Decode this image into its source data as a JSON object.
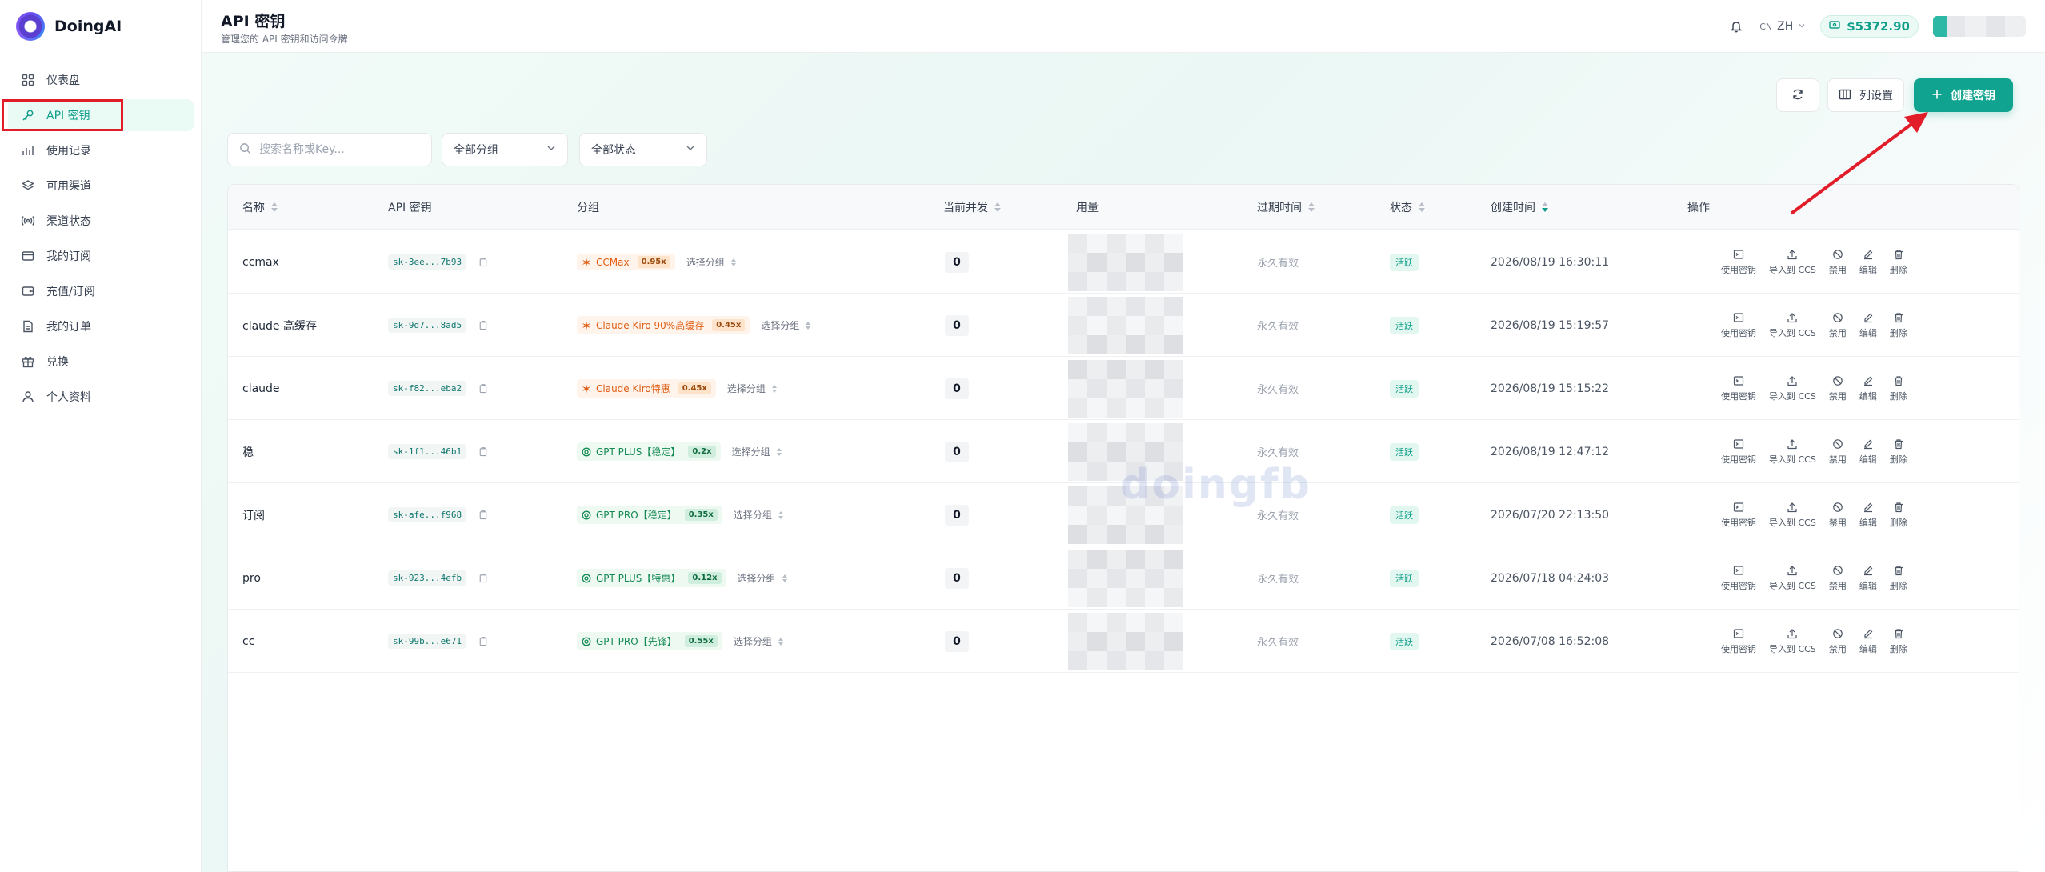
{
  "brand": {
    "name": "DoingAI"
  },
  "sidebar": {
    "items": [
      {
        "label": "仪表盘",
        "icon": "grid-icon"
      },
      {
        "label": "API 密钥",
        "icon": "key-icon",
        "active": true
      },
      {
        "label": "使用记录",
        "icon": "bar-chart-icon"
      },
      {
        "label": "可用渠道",
        "icon": "layers-icon"
      },
      {
        "label": "渠道状态",
        "icon": "signal-icon"
      },
      {
        "label": "我的订阅",
        "icon": "card-icon"
      },
      {
        "label": "充值/订阅",
        "icon": "wallet-icon"
      },
      {
        "label": "我的订单",
        "icon": "document-icon"
      },
      {
        "label": "兑换",
        "icon": "gift-icon"
      },
      {
        "label": "个人资料",
        "icon": "user-icon"
      }
    ]
  },
  "header": {
    "title": "API 密钥",
    "subtitle": "管理您的 API 密钥和访问令牌",
    "lang_code": "CN",
    "lang": "ZH",
    "balance": "$5372.90"
  },
  "toolbar": {
    "columns_label": "列设置",
    "create_label": "创建密钥"
  },
  "filters": {
    "search_placeholder": "搜索名称或Key...",
    "group_select": "全部分组",
    "status_select": "全部状态"
  },
  "table": {
    "columns": {
      "name": "名称",
      "key": "API 密钥",
      "group": "分组",
      "concurrency": "当前并发",
      "usage": "用量",
      "expire": "过期时间",
      "status": "状态",
      "created": "创建时间",
      "actions": "操作"
    },
    "action_labels": {
      "use": "使用密钥",
      "import": "导入到 CCS",
      "disable": "禁用",
      "edit": "编辑",
      "delete": "删除"
    },
    "choose_group": "选择分组",
    "rows": [
      {
        "name": "ccmax",
        "key": "sk-3ee...7b93",
        "group": "CCMax",
        "ratio": "0.95x",
        "kind": "claude",
        "concurrency": "0",
        "expire": "永久有效",
        "status": "活跃",
        "created": "2026/08/19 16:30:11"
      },
      {
        "name": "claude 高缓存",
        "key": "sk-9d7...8ad5",
        "group": "Claude Kiro 90%高缓存",
        "ratio": "0.45x",
        "kind": "claude",
        "concurrency": "0",
        "expire": "永久有效",
        "status": "活跃",
        "created": "2026/08/19 15:19:57"
      },
      {
        "name": "claude",
        "key": "sk-f82...eba2",
        "group": "Claude Kiro特惠",
        "ratio": "0.45x",
        "kind": "claude",
        "concurrency": "0",
        "expire": "永久有效",
        "status": "活跃",
        "created": "2026/08/19 15:15:22"
      },
      {
        "name": "稳",
        "key": "sk-1f1...46b1",
        "group": "GPT PLUS【稳定】",
        "ratio": "0.2x",
        "kind": "gpt",
        "concurrency": "0",
        "expire": "永久有效",
        "status": "活跃",
        "created": "2026/08/19 12:47:12"
      },
      {
        "name": "订阅",
        "key": "sk-afe...f968",
        "group": "GPT PRO【稳定】",
        "ratio": "0.35x",
        "kind": "gpt",
        "concurrency": "0",
        "expire": "永久有效",
        "status": "活跃",
        "created": "2026/07/20 22:13:50"
      },
      {
        "name": "pro",
        "key": "sk-923...4efb",
        "group": "GPT PLUS【特惠】",
        "ratio": "0.12x",
        "kind": "gpt",
        "concurrency": "0",
        "expire": "永久有效",
        "status": "活跃",
        "created": "2026/07/18 04:24:03"
      },
      {
        "name": "cc",
        "key": "sk-99b...e671",
        "group": "GPT PRO【先锋】",
        "ratio": "0.55x",
        "kind": "gpt",
        "concurrency": "0",
        "expire": "永久有效",
        "status": "活跃",
        "created": "2026/07/08 16:52:08"
      }
    ]
  },
  "watermark": "doingfb",
  "colors": {
    "accent": "#10a38f",
    "highlight_box": "#e11d2a"
  }
}
